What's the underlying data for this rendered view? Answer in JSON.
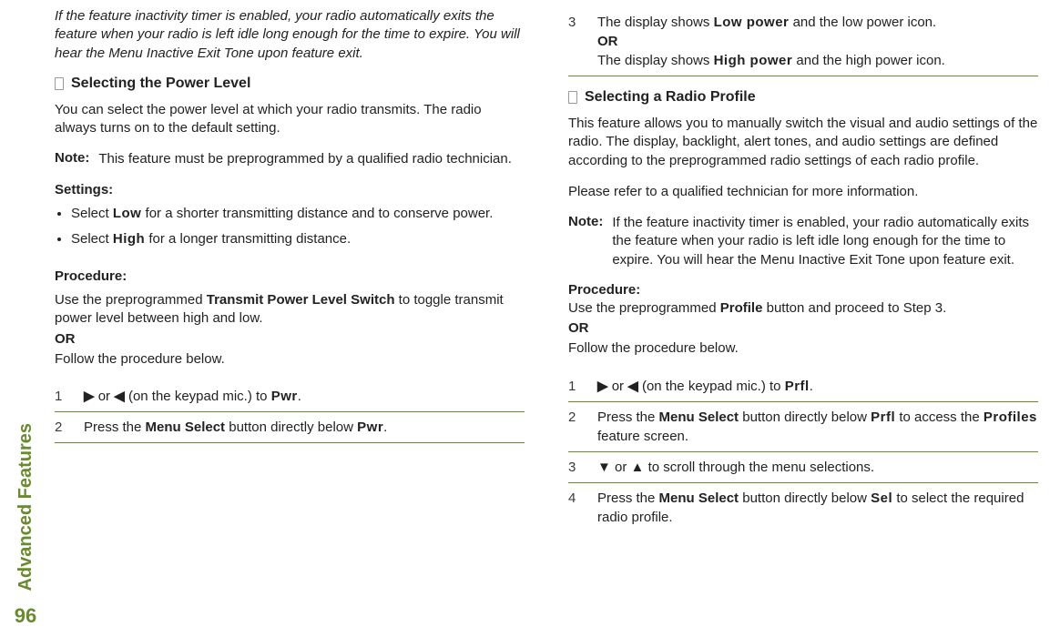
{
  "sidebar": {
    "label": "Advanced Features",
    "page": "96"
  },
  "left": {
    "intro": "If the feature inactivity timer is enabled, your radio automatically exits the feature when your radio is left idle long enough for the time to expire. You will hear the Menu Inactive Exit Tone upon feature exit.",
    "section_title": "Selecting the Power Level",
    "desc": "You can select the power level at which your radio transmits. The radio always turns on to the default setting.",
    "note_label": "Note:",
    "note": "This feature must be preprogrammed by a qualified radio technician.",
    "settings_label": "Settings:",
    "settings": [
      {
        "prefix": "Select ",
        "term": "Low",
        "suffix": " for a shorter transmitting distance and to conserve power."
      },
      {
        "prefix": "Select ",
        "term": "High",
        "suffix": " for a longer transmitting distance."
      }
    ],
    "procedure_label": "Procedure:",
    "proc_intro1_a": "Use the preprogrammed ",
    "proc_intro1_b": "Transmit Power Level Switch",
    "proc_intro1_c": " to toggle transmit power level between high and low.",
    "or": "OR",
    "proc_intro2": "Follow the procedure below.",
    "steps": [
      {
        "n": "1",
        "a": "",
        "arrow1": "▶",
        "mid": " or ",
        "arrow2": "◀",
        "b": " (on the keypad mic.) to ",
        "term": "Pwr",
        "c": "."
      },
      {
        "n": "2",
        "a": "Press the ",
        "bold": "Menu Select",
        "b": " button directly below ",
        "term": "Pwr",
        "c": "."
      }
    ]
  },
  "right": {
    "step3": {
      "n": "3",
      "line1_a": "The display shows ",
      "line1_term": "Low power",
      "line1_b": " and the low power icon.",
      "or": "OR",
      "line2_a": "The display shows ",
      "line2_term": "High power",
      "line2_b": " and the high power icon."
    },
    "section_title": "Selecting a Radio Profile",
    "desc": "This feature allows you to manually switch the visual and audio settings of the radio. The display, backlight, alert tones, and audio settings are defined according to the preprogrammed radio settings of each radio profile.",
    "refer": "Please refer to a qualified technician for more information.",
    "note_label": "Note:",
    "note": "If the feature inactivity timer is enabled, your radio automatically exits the feature when your radio is left idle long enough for the time to expire. You will hear the Menu Inactive Exit Tone upon feature exit.",
    "procedure_label": "Procedure:",
    "proc_intro1_a": "Use the preprogrammed ",
    "proc_intro1_b": "Profile",
    "proc_intro1_c": " button and proceed to Step 3.",
    "or": "OR",
    "proc_intro2": "Follow the procedure below.",
    "steps": [
      {
        "n": "1",
        "arrow1": "▶",
        "mid": " or ",
        "arrow2": "◀",
        "b": " (on the keypad mic.) to ",
        "term": "Prfl",
        "c": "."
      },
      {
        "n": "2",
        "a": "Press the ",
        "bold": "Menu Select",
        "b": " button directly below ",
        "term": "Prfl",
        "c": " to access the ",
        "term2": "Profiles",
        "d": " feature screen."
      },
      {
        "n": "3",
        "arrow1": "▼",
        "mid": " or ",
        "arrow2": "▲",
        "b": " to scroll through the menu selections."
      },
      {
        "n": "4",
        "a": "Press the ",
        "bold": "Menu Select",
        "b": " button directly below ",
        "term": "Sel",
        "c": " to select the required radio profile."
      }
    ]
  }
}
